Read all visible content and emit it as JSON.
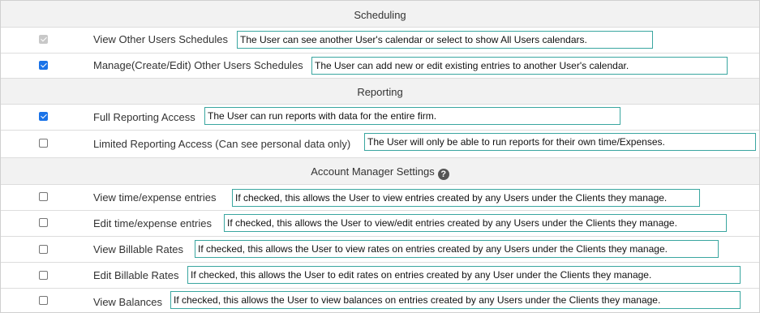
{
  "sections": {
    "scheduling": "Scheduling",
    "reporting": "Reporting",
    "account_manager": "Account Manager Settings"
  },
  "help_icon": "?",
  "rows": [
    {
      "name": "View Other Users Schedules",
      "desc": "The User can see another User's calendar or select to show All Users calendars.",
      "state": "checked-disabled"
    },
    {
      "name": "Manage(Create/Edit) Other Users Schedules",
      "desc": "The User can add new or edit existing entries to another User's calendar.",
      "state": "checked"
    },
    {
      "name": "Full Reporting Access",
      "desc": "The User can run reports with data for the entire firm.",
      "state": "checked"
    },
    {
      "name": "Limited Reporting Access (Can see personal data only)",
      "desc": "The User will only be able to run reports for their own time/Expenses.",
      "state": "unchecked"
    },
    {
      "name": "View time/expense entries",
      "desc": "If checked, this allows the User to view entries created by any Users under the Clients they manage.",
      "state": "unchecked"
    },
    {
      "name": "Edit time/expense entries",
      "desc": "If checked, this allows the User to view/edit entries created by any Users under the Clients they manage.",
      "state": "unchecked"
    },
    {
      "name": "View Billable Rates",
      "desc": "If checked, this allows the User to view rates on entries created by any Users under the Clients they manage.",
      "state": "unchecked"
    },
    {
      "name": "Edit Billable Rates",
      "desc": "If checked, this allows the User to edit rates on entries created by any User under the Clients they manage.",
      "state": "unchecked"
    },
    {
      "name": "View Balances",
      "desc": "If checked, this allows the User to view balances on entries created by any Users under the Clients they manage.",
      "state": "unchecked"
    }
  ]
}
